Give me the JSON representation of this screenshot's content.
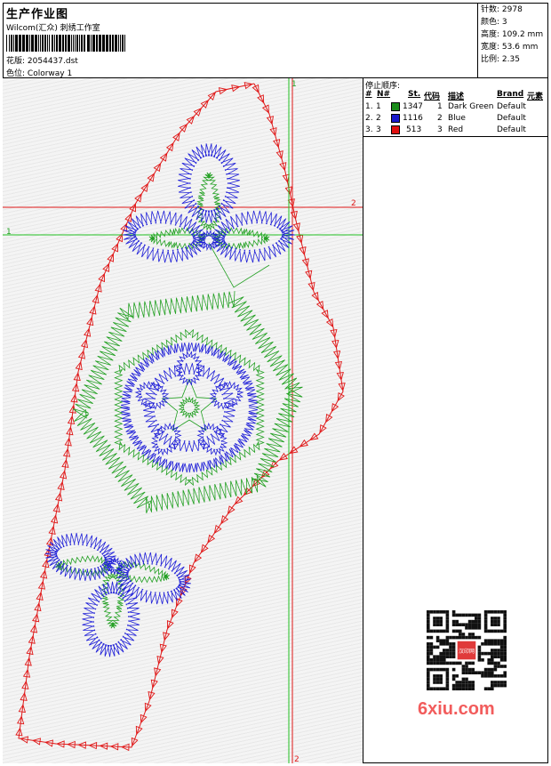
{
  "header": {
    "title": "生产作业图",
    "company": "Wilcom(汇众) 刺绣工作室",
    "design_label": "花版:",
    "design_value": "2054437.dst",
    "colorway_label": "色位:",
    "colorway_value": "Colorway 1"
  },
  "stats": [
    {
      "label": "针数:",
      "value": "2978"
    },
    {
      "label": "颜色:",
      "value": "3"
    },
    {
      "label": "高度:",
      "value": "109.2 mm"
    },
    {
      "label": "宽度:",
      "value": "53.6 mm"
    },
    {
      "label": "比例:",
      "value": "2.35"
    }
  ],
  "stop_sequence": {
    "caption": "停止顺序:",
    "columns": [
      "#",
      "N#",
      "St.",
      "代码",
      "描述",
      "Brand",
      "元素"
    ],
    "rows": [
      {
        "num": "1.",
        "n": "1",
        "stitches": "1347",
        "code": "1",
        "desc": "Dark Green",
        "brand": "Default",
        "color": "#1a8c1a"
      },
      {
        "num": "2.",
        "n": "2",
        "stitches": "1116",
        "code": "2",
        "desc": "Blue",
        "brand": "Default",
        "color": "#1a1acc"
      },
      {
        "num": "3.",
        "n": "3",
        "stitches": "513",
        "code": "3",
        "desc": "Red",
        "brand": "Default",
        "color": "#e01010"
      }
    ]
  },
  "guides": {
    "h_red_label": "2",
    "h_green_label": "1",
    "v_green_label": "1",
    "v_red_label": "2"
  },
  "watermark": {
    "text": "6xiu.com",
    "qr_center": "汉印网"
  },
  "colors": {
    "green": "#22a022",
    "blue": "#2020d8",
    "red": "#e01818"
  }
}
